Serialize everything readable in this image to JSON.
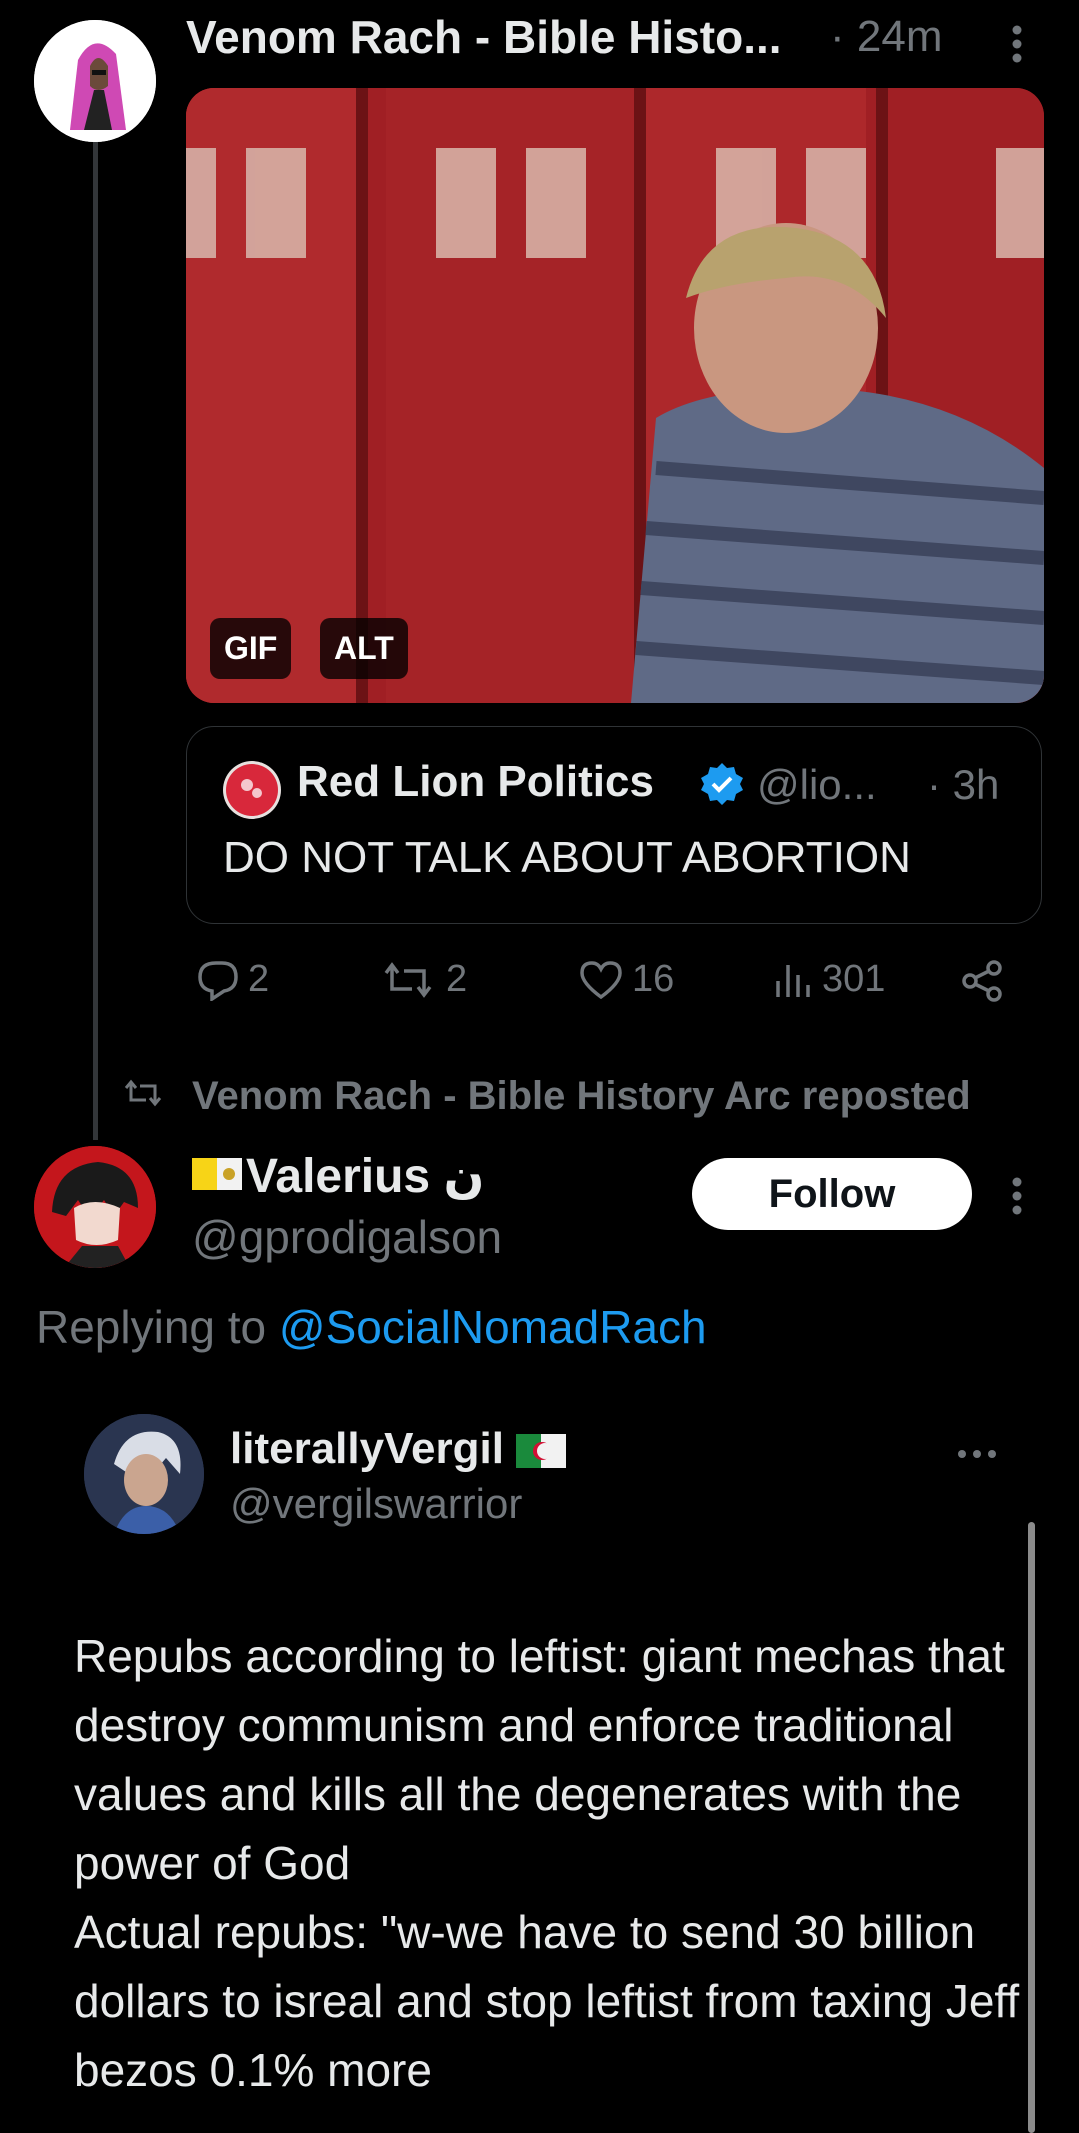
{
  "post1": {
    "author": "Venom Rach - Bible Histo...",
    "time": "· 24m",
    "media_badges": {
      "gif": "GIF",
      "alt": "ALT"
    },
    "quote": {
      "author": "Red Lion Politics",
      "handle": "@lio...",
      "time": "· 3h",
      "text": "DO NOT TALK ABOUT ABORTION"
    },
    "actions": {
      "replies": "2",
      "reposts": "2",
      "likes": "16",
      "views": "301"
    }
  },
  "repost_banner": "Venom Rach - Bible History Arc reposted",
  "post2": {
    "display_name": "Valerius ن",
    "handle": "@gprodigalson",
    "follow_label": "Follow",
    "replying_prefix": "Replying to ",
    "replying_to": "@SocialNomadRach",
    "embedded": {
      "name": "literallyVergil",
      "handle": "@vergilswarrior",
      "body": "Repubs according to leftist: giant mechas that destroy communism and enforce traditional values and kills all the degenerates with the power of God\nActual repubs: \"w-we have to send 30 billion dollars to isreal and stop leftist from taxing Jeff bezos 0.1% more"
    }
  },
  "colors": {
    "background": "#000000",
    "link": "#1d9bf0",
    "verified": "#1d9bf0",
    "muted": "#71767b"
  }
}
